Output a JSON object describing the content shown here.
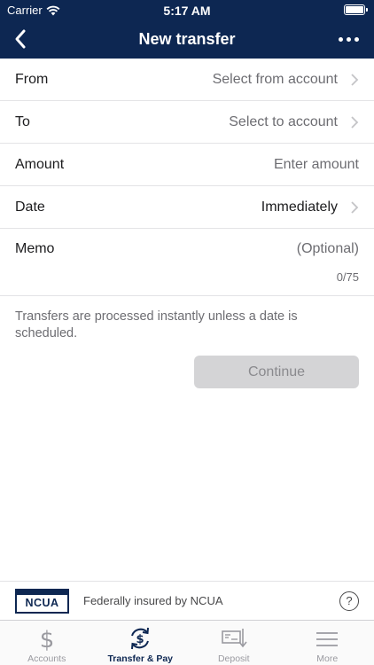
{
  "status_bar": {
    "carrier": "Carrier",
    "time": "5:17 AM"
  },
  "nav": {
    "title": "New transfer"
  },
  "form": {
    "from": {
      "label": "From",
      "value": "Select from account"
    },
    "to": {
      "label": "To",
      "value": "Select to account"
    },
    "amount": {
      "label": "Amount",
      "placeholder": "Enter amount"
    },
    "date": {
      "label": "Date",
      "value": "Immediately"
    },
    "memo": {
      "label": "Memo",
      "placeholder": "(Optional)",
      "counter": "0/75"
    }
  },
  "note": "Transfers are processed instantly unless a date is scheduled.",
  "continue_label": "Continue",
  "insured": {
    "logo_text": "NCUA",
    "text": "Federally insured by NCUA",
    "help_symbol": "?"
  },
  "tabs": [
    {
      "label": "Accounts",
      "icon": "dollar-icon"
    },
    {
      "label": "Transfer & Pay",
      "icon": "transfer-pay-icon",
      "active": true
    },
    {
      "label": "Deposit",
      "icon": "check-deposit-icon"
    },
    {
      "label": "More",
      "icon": "menu-icon"
    }
  ],
  "colors": {
    "header": "#0d2752",
    "accent": "#0d2752",
    "muted": "#6d6d72"
  }
}
